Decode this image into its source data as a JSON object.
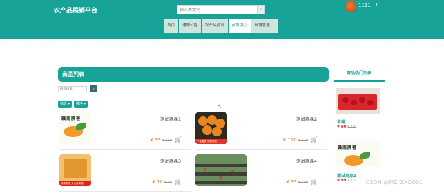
{
  "header": {
    "site_title": "农产品展销平台",
    "search_placeholder": "输入关键词",
    "search_icon": "search-icon",
    "user_name": "1111",
    "user_caret": "▾"
  },
  "nav": {
    "items": [
      {
        "label": "首页"
      },
      {
        "label": "通知公告"
      },
      {
        "label": "农产品资讯"
      },
      {
        "label": "商城中心"
      },
      {
        "label": "商城管理"
      }
    ],
    "active_index": 3
  },
  "product_panel": {
    "title": "商品列表",
    "search_placeholder": "商品搜索",
    "filter_label": "筛选",
    "sort_label": "排序"
  },
  "products": [
    {
      "name": "测试商品1",
      "price": "¥ 99",
      "old_price": "¥ 110",
      "image_text": "赣南脐橙"
    },
    {
      "name": "测试商品2",
      "price": "¥ 110",
      "old_price": "¥ 220",
      "image_text": "产地直发 现摘现发"
    },
    {
      "name": "测试商品3",
      "price": "¥ 10",
      "old_price": "¥ 20",
      "image_text": "赣南脐橙 无公害果园"
    },
    {
      "name": "测试商品4",
      "price": "¥ 99",
      "old_price": "¥ 199",
      "image_text": ""
    }
  ],
  "sidebar": {
    "title": "商品热门列表",
    "items": [
      {
        "name": "草莓",
        "price": "¥ 80",
        "old_price": "¥ 100"
      },
      {
        "name": "测试商品1",
        "price": "¥ 99",
        "old_price": "¥ 110",
        "image_text": "赣南脐橙"
      }
    ]
  },
  "watermark": "CSDN @MZ_ZXD001",
  "colors": {
    "primary": "#17a398",
    "price": "#ee7a2a",
    "nav_bg": "#cfe6de"
  }
}
